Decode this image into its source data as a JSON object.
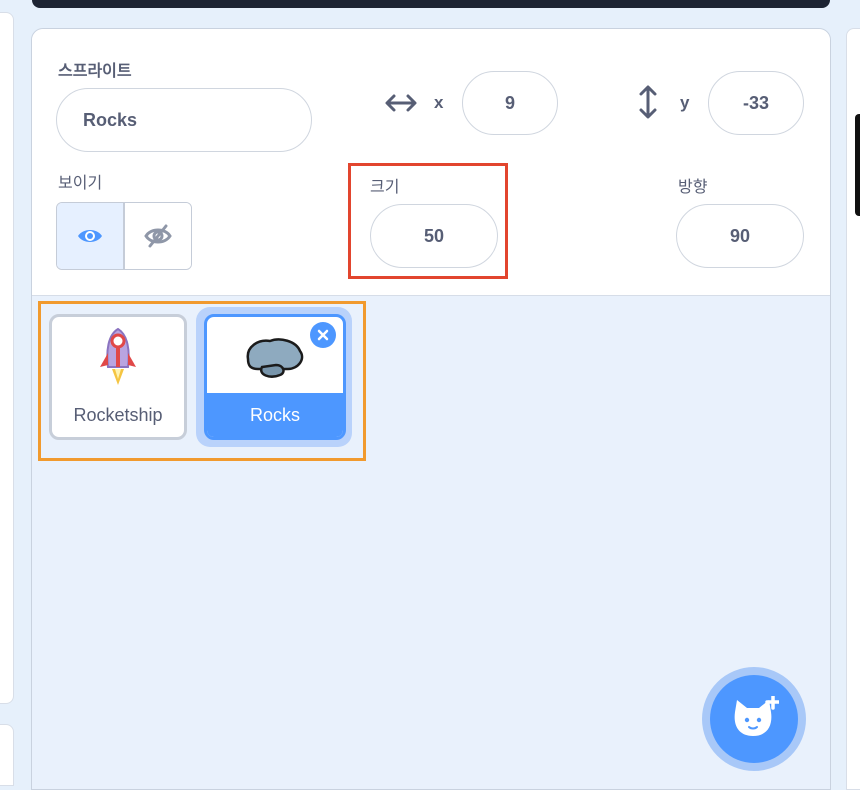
{
  "sprite_info": {
    "sprite_label": "스프라이트",
    "sprite_name": "Rocks",
    "x_label": "x",
    "x_value": "9",
    "y_label": "y",
    "y_value": "-33",
    "show_label": "보이기",
    "size_label": "크기",
    "size_value": "50",
    "direction_label": "방향",
    "direction_value": "90"
  },
  "sprites": [
    {
      "name": "Rocketship",
      "selected": false,
      "icon": "rocketship-thumbnail"
    },
    {
      "name": "Rocks",
      "selected": true,
      "icon": "rocks-thumbnail"
    }
  ],
  "colors": {
    "accent": "#4d97ff",
    "size_highlight": "#e2452e",
    "sprites_highlight": "#f19a2e"
  },
  "icons": {
    "x_axis": "horizontal-arrows-icon",
    "y_axis": "vertical-arrows-icon",
    "show": "eye-icon",
    "hide": "eye-slash-icon",
    "delete": "close-icon",
    "add_sprite": "cat-plus-icon"
  }
}
